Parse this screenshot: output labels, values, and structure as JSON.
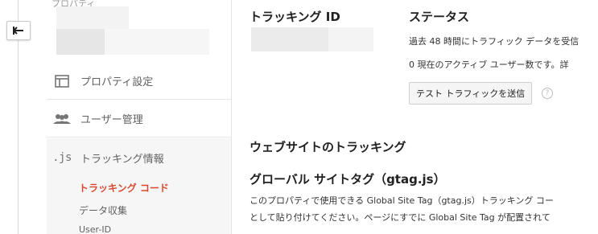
{
  "sidebar": {
    "property_label": "プロパティ",
    "items": [
      {
        "label": "プロパティ設定",
        "icon": "property-settings-icon"
      },
      {
        "label": "ユーザー管理",
        "icon": "users-icon"
      },
      {
        "label": "トラッキング情報",
        "icon": "js-icon",
        "icon_text": ".js"
      }
    ],
    "tracking_sub": [
      {
        "label": "トラッキング コード",
        "active": true
      },
      {
        "label": "データ収集",
        "active": false
      },
      {
        "label": "User-ID",
        "active": false
      }
    ]
  },
  "main": {
    "tracking_id_title": "トラッキング ID",
    "status_title": "ステータス",
    "status_line1": "過去 48 時間にトラフィック データを受信",
    "status_line2": "0 現在のアクティブ ユーザー数です。詳",
    "send_test_label": "テスト トラフィックを送信",
    "help_glyph": "?",
    "website_tracking_title": "ウェブサイトのトラッキング",
    "gtag_title": "グローバル サイトタグ（gtag.js）",
    "gtag_desc1": "このプロパティで使用できる Global Site Tag（gtag.js）トラッキング コー",
    "gtag_desc2": "として貼り付けてください。ページにすでに Global Site Tag が配置されて"
  },
  "colors": {
    "active_sub": "#d84a2f",
    "sidebar_active_bg": "#f6f6f6"
  }
}
